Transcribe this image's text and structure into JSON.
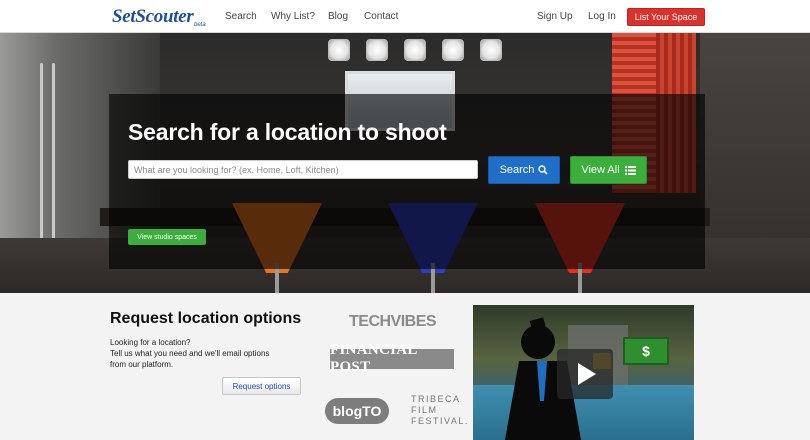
{
  "nav": {
    "logo": "SetScouter",
    "logo_beta": "beta",
    "links": [
      "Search",
      "Why List?",
      "Blog",
      "Contact"
    ],
    "sign_up": "Sign Up",
    "log_in": "Log In",
    "list_space": "List Your Space"
  },
  "hero": {
    "title": "Search for a location to shoot",
    "search_placeholder": "What are you looking for? (ex. Home, Loft, Kitchen)",
    "search_button": "Search",
    "view_all_button": "View All",
    "studio_button": "View studio spaces"
  },
  "request": {
    "title": "Request location options",
    "lines": [
      "Looking for a location?",
      "Tell us what you need and we'll email options",
      "from our platform."
    ],
    "button": "Request options"
  },
  "press": {
    "techvibes": "TECHVIBES",
    "financial_post": "FINANCIAL POST",
    "blogto": "blogTO",
    "tribeca": [
      "TRIBECA",
      "FILM",
      "FESTIVAL."
    ]
  },
  "video": {
    "money_symbol": "$"
  },
  "colors": {
    "brand_blue": "#1f4f9c",
    "list_red": "#d9312b",
    "search_blue": "#1f6fc9",
    "view_green": "#3cae3c"
  }
}
